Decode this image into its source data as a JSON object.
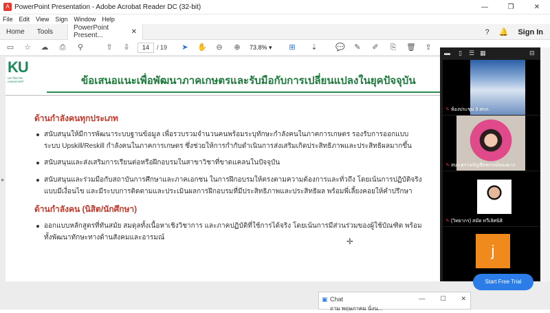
{
  "titlebar": {
    "title": "PowerPoint Presentation - Adobe Acrobat Reader DC (32-bit)"
  },
  "menu": [
    "File",
    "Edit",
    "View",
    "Sign",
    "Window",
    "Help"
  ],
  "tabs": {
    "home": "Home",
    "tools": "Tools",
    "doc": "PowerPoint Present...",
    "sign_in": "Sign In"
  },
  "toolbar": {
    "page_current": "14",
    "page_total": "/  19",
    "zoom": "73.8%"
  },
  "slide": {
    "logo_text": "KU",
    "logo_sub1": "มหาวิทยาลัย",
    "logo_sub2": "เกษตรศาสตร์",
    "title": "ข้อเสนอแนะเพื่อพัฒนาภาคเกษตรและรับมือกับการเปลี่ยนแปลงในยุคปัจจุบัน",
    "section1": "ด้านกำลังคนทุกประเภท",
    "b1_l1": "สนับสนุนให้มีการพัฒนาระบบฐานข้อมูล เพื่อรวบรวมจำนวนคนพร้อมระบุทักษะกำลังคนในภาคการเกษตร รองรับการออกแบบ",
    "b1_l2": "ระบบ Upskill/Reskill กำลังคนในภาคการเกษตร  ซึ่งช่วยให้การกำกับดำเนินการส่งเสริมเกิดประสิทธิภาพและประสิทธิผลมากขึ้น",
    "b2": "สนับสนุนและส่งเสริมการเรียนต่อหรือฝึกอบรมในสาขาวิชาที่ขาดแคลนในปัจจุบัน",
    "b3_l1": "สนับสนุนและร่วมมือกับสถาบันการศึกษาและภาคเอกชน ในการฝึกอบรมให้ตรงตามความต้องการและทั่วถึง โดยเน้นการปฏิบัติจริง",
    "b3_l2": "แบบมีเงื่อนไข และมีระบบการติดตามและประเมินผลการฝึกอบรมที่มีประสิทธิภาพและประสิทธิผล พร้อมพี่เลี้ยงคอยให้คำปรึกษา",
    "section2": "ด้านกำลังคน (นิสิต/นักศึกษา)",
    "b4_l1": "ออกแบบหลักสูตรที่ทันสมัย สมดุลทั้งเนื้อหาเชิงวิชาการ และภาคปฏิบัติที่ใช้การได้จริง  โดยเน้นการมีส่วนร่วมของผู้ใช้บัณฑิต พร้อม",
    "b4_l2": "ทั้งพัฒนาทักษะทางด้านสังคมและอารมณ์"
  },
  "zoom": {
    "tile1_name": "ห้องประชุม 3 สกภ.",
    "tile2_name": "สนง.ตรวจบัญชีสหกรณ์ทองผาง",
    "tile3_name": "(วิทยากร) สมัด ทวีเลิศนิธิ",
    "tile4_initial": "j",
    "start_btn": "Start Free Trial"
  },
  "chat": {
    "title": "Chat",
    "preview": "ถาม พฤษภาคม นั่งน..."
  },
  "colors": {
    "title_green": "#1b7a3a",
    "section_red": "#c0392b",
    "zoom_orange": "#f08a1c"
  }
}
